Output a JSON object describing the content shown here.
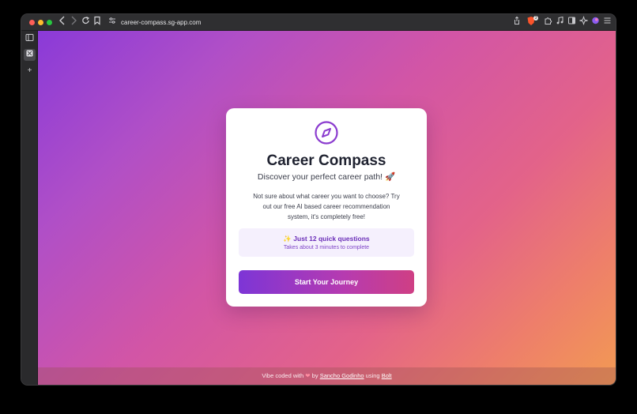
{
  "browser": {
    "url": "career-compass.sg-app.com",
    "icons": {
      "back": "chevron-left-icon",
      "forward": "chevron-right-icon",
      "reload": "reload-icon",
      "bookmark": "bookmark-icon",
      "site_settings": "site-settings-icon",
      "share": "share-icon",
      "shields": "brave-shields-icon",
      "shields_count": "3",
      "extensions": "puzzle-icon",
      "media": "music-icon",
      "sidebar_toggle": "sidebar-icon",
      "leo": "leo-ai-icon",
      "wallet": "wallet-icon",
      "menu": "hamburger-menu-icon"
    }
  },
  "sidebar": {
    "items": [
      {
        "icon": "sidebar-panel-icon"
      },
      {
        "icon": "bolt-app-icon"
      },
      {
        "label": "+"
      }
    ]
  },
  "card": {
    "title": "Career Compass",
    "subtitle": "Discover your perfect career path! 🚀",
    "description": "Not sure about what career you want to choose? Try out our free AI based career recommendation system, it's completely free!",
    "info_title": "✨ Just 12 quick questions",
    "info_subtitle": "Takes about 3 minutes to complete",
    "cta_label": "Start Your Journey",
    "accent_color": "#8b3ccf"
  },
  "footer": {
    "prefix": "Vibe coded with",
    "heart": "❤",
    "by": "by",
    "author": "Sancho Godinho",
    "using": "using",
    "tool": "Bolt"
  }
}
